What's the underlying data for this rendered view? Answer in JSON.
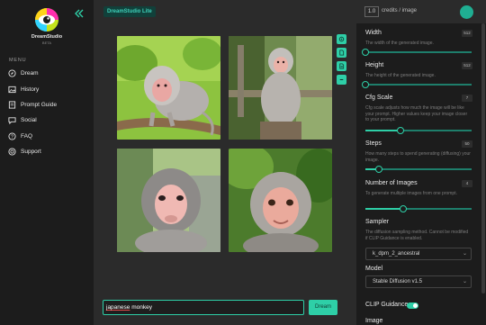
{
  "header": {
    "version_badge": "DreamStudio Lite",
    "credits_value": "1.0",
    "credits_label": "credits / image"
  },
  "sidebar": {
    "app_name": "DreamStudio",
    "app_sub": "BETA",
    "menu_label": "MENU",
    "items": [
      {
        "label": "Dream",
        "icon": "compass-icon"
      },
      {
        "label": "History",
        "icon": "image-icon"
      },
      {
        "label": "Prompt Guide",
        "icon": "book-icon"
      },
      {
        "label": "Social",
        "icon": "chat-icon"
      },
      {
        "label": "FAQ",
        "icon": "question-icon"
      },
      {
        "label": "Support",
        "icon": "support-icon"
      }
    ]
  },
  "main": {
    "images": [
      "monkey-on-branch",
      "monkey-on-stump",
      "monkey-portrait-left",
      "monkey-portrait-right"
    ],
    "tools": [
      "zoom-icon",
      "file-icon",
      "file-text-icon",
      "minus-icon"
    ],
    "prompt_word1": "japanese",
    "prompt_word2": "monkey",
    "dream_label": "Dream"
  },
  "panel": {
    "width": {
      "title": "Width",
      "desc": "The width of the generated image.",
      "value": "512",
      "fraction": 0.0
    },
    "height": {
      "title": "Height",
      "desc": "The height of the generated image.",
      "value": "512",
      "fraction": 0.0
    },
    "cfg": {
      "title": "Cfg Scale",
      "desc": "Cfg scale adjusts how much the image will be like your prompt. Higher values keep your image closer to your prompt.",
      "value": "7",
      "fraction": 0.33
    },
    "steps": {
      "title": "Steps",
      "desc": "How many steps to spend generating (diffusing) your image.",
      "value": "50",
      "fraction": 0.13
    },
    "images": {
      "title": "Number of Images",
      "desc": "To generate multiple images from one prompt.",
      "value": "4",
      "fraction": 0.36
    },
    "sampler": {
      "title": "Sampler",
      "desc": "The diffusion sampling method. Cannot be modified if CLIP Guidance is enabled.",
      "value": "k_dpm_2_ancestral"
    },
    "model": {
      "title": "Model",
      "value": "Stable Diffusion v1.5"
    },
    "clip": {
      "title": "CLIP Guidance",
      "enabled": true
    },
    "image_label": "Image"
  },
  "colors": {
    "accent": "#2ecfa7",
    "sidebar_bg": "#1c1c1c",
    "main_bg": "#2b2b2b"
  }
}
